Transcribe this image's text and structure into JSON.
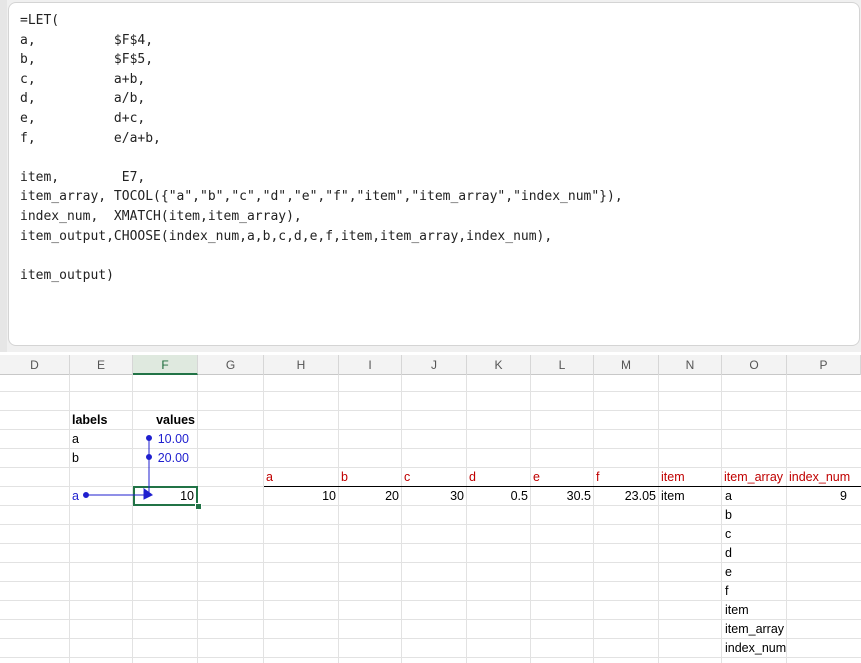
{
  "formula": "=LET(\na,          $F$4,\nb,          $F$5,\nc,          a+b,\nd,          a/b,\ne,          d+c,\nf,          e/a+b,\n\nitem,        E7,\nitem_array, TOCOL({\"a\",\"b\",\"c\",\"d\",\"e\",\"f\",\"item\",\"item_array\",\"index_num\"}),\nindex_num,  XMATCH(item,item_array),\nitem_output,CHOOSE(index_num,a,b,c,d,e,f,item,item_array,index_num),\n\nitem_output)",
  "columns": [
    "D",
    "E",
    "F",
    "G",
    "H",
    "I",
    "J",
    "K",
    "L",
    "M",
    "N",
    "O",
    "P"
  ],
  "labels_table": {
    "labels_header": "labels",
    "values_header": "values",
    "rows": [
      {
        "label": "a",
        "value": "10.00"
      },
      {
        "label": "b",
        "value": "20.00"
      }
    ]
  },
  "item_cell": "a",
  "result_cell": "10",
  "spill_headers": [
    "a",
    "b",
    "c",
    "d",
    "e",
    "f",
    "item",
    "item_array",
    "index_num"
  ],
  "spill_values": [
    "10",
    "20",
    "30",
    "0.5",
    "30.5",
    "23.05",
    "item"
  ],
  "item_array_values": [
    "a",
    "b",
    "c",
    "d",
    "e",
    "f",
    "item",
    "item_array",
    "index_num"
  ],
  "index_num_value": "9",
  "colors": {
    "accent_green": "#217346",
    "precedent_arrow": "#1f1fcf",
    "header_red": "#c00000"
  }
}
